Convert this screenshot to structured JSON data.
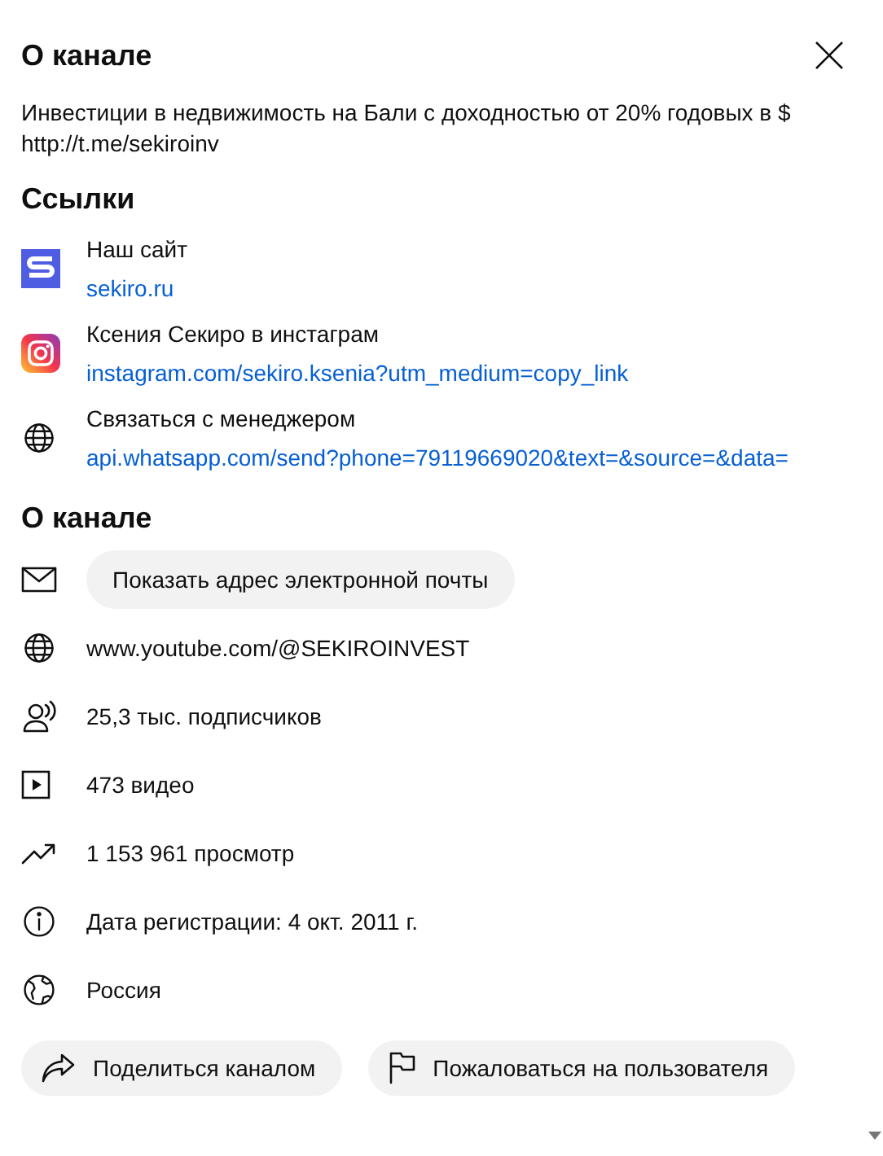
{
  "header": {
    "title": "О канале"
  },
  "description": [
    "Инвестиции в недвижимость на Бали с доходностью от 20% годовых в $",
    "http://t.me/sekiroinv"
  ],
  "links_section": {
    "title": "Ссылки",
    "links": [
      {
        "title": "Наш сайт",
        "url": "sekiro.ru"
      },
      {
        "title": "Ксения Секиро в инстаграм",
        "url": "instagram.com/sekiro.ksenia?utm_medium=copy_link"
      },
      {
        "title": "Связаться с менеджером",
        "url": "api.whatsapp.com/send?phone=79119669020&text=&source=&data="
      }
    ]
  },
  "details_section": {
    "title": "О канале",
    "items": [
      {
        "kind": "button",
        "text": "Показать адрес электронной почты"
      },
      {
        "kind": "text",
        "text": "www.youtube.com/@SEKIROINVEST"
      },
      {
        "kind": "text",
        "text": "25,3 тыс. подписчиков"
      },
      {
        "kind": "text",
        "text": "473 видео"
      },
      {
        "kind": "text",
        "text": "1 153 961 просмотр"
      },
      {
        "kind": "text",
        "text": "Дата регистрации: 4 окт. 2011 г."
      },
      {
        "kind": "text",
        "text": "Россия"
      }
    ]
  },
  "actions": [
    {
      "label": "Поделиться каналом"
    },
    {
      "label": "Пожаловаться на пользователя"
    }
  ]
}
